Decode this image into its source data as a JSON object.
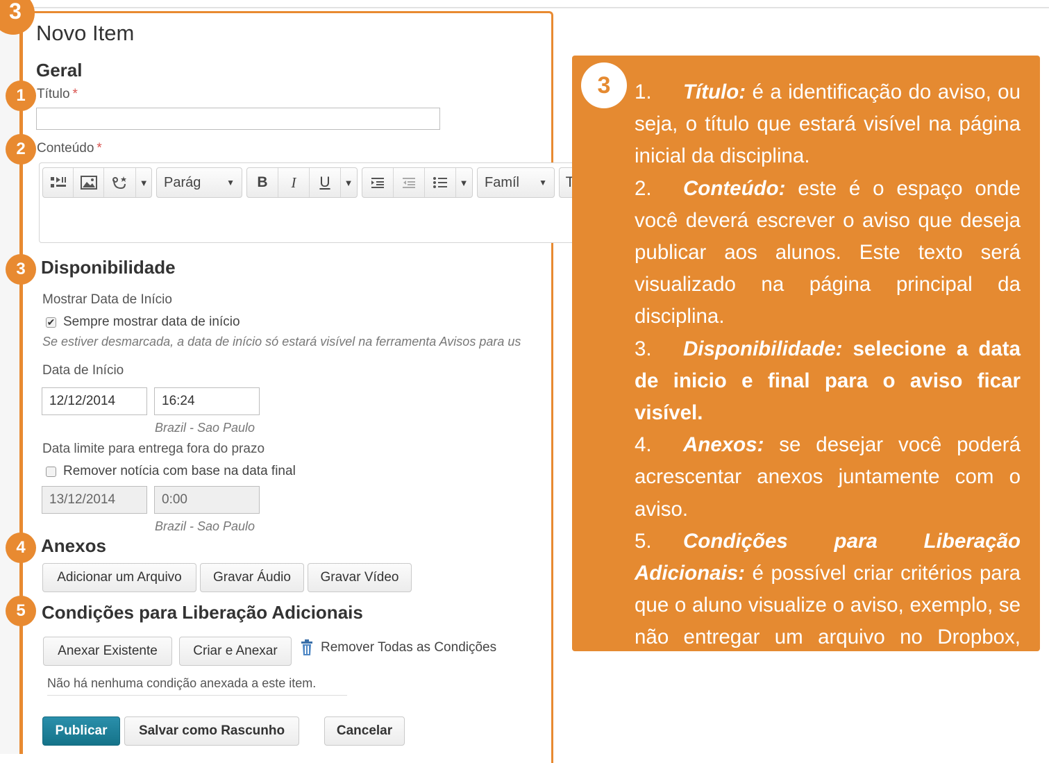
{
  "page": {
    "title": "Novo Item",
    "section_general": "Geral"
  },
  "badges": {
    "corner": "3",
    "titulo": "1",
    "conteudo": "2",
    "disponibilidade": "3",
    "anexos": "4",
    "condicoes": "5",
    "panel": "3"
  },
  "fields": {
    "titulo_label": "Título",
    "required_mark": "*",
    "titulo_value": "",
    "conteudo_label": "Conteúdo"
  },
  "editor": {
    "icons": [
      "media-icon",
      "image-icon",
      "insert-stuff-icon"
    ],
    "format_select": "Parág",
    "bold": "B",
    "italic": "I",
    "underline": "U",
    "font_select": "Famíl",
    "font_size_fragment": "T"
  },
  "availability": {
    "heading": "Disponibilidade",
    "show_start_label": "Mostrar Data de Início",
    "always_show_label": "Sempre mostrar data de início",
    "always_show_checked": true,
    "hint": "Se estiver desmarcada, a data de início só estará visível na ferramenta Avisos para us",
    "start_label": "Data de Início",
    "start_date": "12/12/2014",
    "start_time": "16:24",
    "timezone": "Brazil - Sao Paulo",
    "end_label": "Data limite para entrega fora do prazo",
    "remove_label": "Remover notícia com base na data final",
    "remove_checked": false,
    "end_date": "13/12/2014",
    "end_time": "0:00",
    "end_timezone": "Brazil - Sao Paulo"
  },
  "attachments": {
    "heading": "Anexos",
    "add_file": "Adicionar um Arquivo",
    "record_audio": "Gravar Áudio",
    "record_video": "Gravar Vídeo"
  },
  "conditions": {
    "heading": "Condições para Liberação Adicionais",
    "attach_existing": "Anexar Existente",
    "create_attach": "Criar e Anexar",
    "remove_all": "Remover Todas as Condições",
    "empty": "Não há nenhuma condição anexada a este item."
  },
  "actions": {
    "publish": "Publicar",
    "save_draft": "Salvar como Rascunho",
    "cancel": "Cancelar"
  },
  "panel": {
    "items": [
      {
        "num": "1.",
        "term": "Título:",
        "text": " é a identificação do aviso, ou seja, o título que estará visível na página inicial da disciplina."
      },
      {
        "num": "2.",
        "term": "Conteúdo:",
        "text": " este é o espaço onde você deverá escrever o aviso que deseja publicar aos alunos. Este texto será visualizado na página principal da disciplina."
      },
      {
        "num": "3.",
        "term": "Disponibilidade:",
        "text": " selecione a data de inicio e final para o aviso ficar visível."
      },
      {
        "num": "4.",
        "term": "Anexos:",
        "text": " se desejar você poderá acrescentar anexos juntamente com o aviso."
      },
      {
        "num": "5.",
        "term": "Condições para Liberação Adicionais:",
        "text": " é possível criar critérios para que o aluno visualize o aviso, exemplo, se não entregar um arquivo no Dropbox, então visualize este aviso (veja o tutorial Condições para Liberação Adicionais)."
      }
    ]
  },
  "colors": {
    "accent": "#e88a31",
    "primary_button": "#1a7f99",
    "required": "#d9534f"
  }
}
